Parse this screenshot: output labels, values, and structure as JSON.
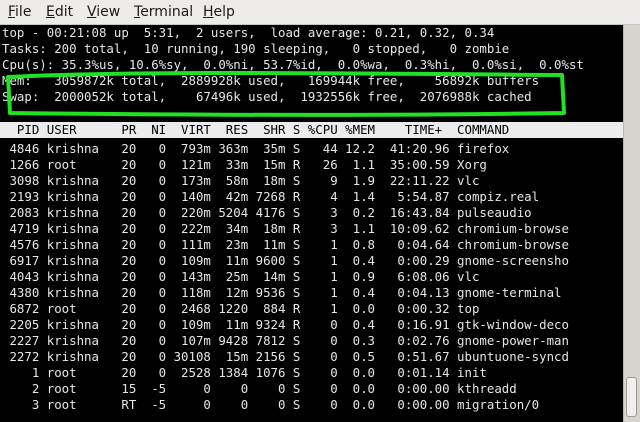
{
  "menubar": {
    "file": {
      "a": "F",
      "b": "ile"
    },
    "edit": {
      "a": "E",
      "b": "dit"
    },
    "view": {
      "a": "V",
      "b": "iew"
    },
    "terminal": {
      "a": "T",
      "b": "erminal"
    },
    "help": {
      "a": "H",
      "b": "elp"
    }
  },
  "summary": {
    "line1": "top - 00:21:08 up  5:31,  2 users,  load average: 0.21, 0.32, 0.34",
    "line2": "Tasks: 200 total,  10 running, 190 sleeping,   0 stopped,   0 zombie",
    "line3": "Cpu(s): 35.3%us, 10.6%sy,  0.0%ni, 53.7%id,  0.0%wa,  0.3%hi,  0.0%si,  0.0%st",
    "mem": "Mem:   3059872k total,  2889928k used,   169944k free,    56892k buffers",
    "swap": "Swap:  2000052k total,    67496k used,  1932556k free,  2076988k cached"
  },
  "header": "  PID USER      PR  NI  VIRT  RES  SHR S %CPU %MEM    TIME+  COMMAND",
  "processes": [
    " 4846 krishna   20   0  793m 363m  35m S   44 12.2  41:20.96 firefox",
    " 1266 root      20   0  121m  33m  15m R   26  1.1  35:00.59 Xorg",
    " 3098 krishna   20   0  173m  58m  18m S    9  1.9  22:11.22 vlc",
    " 2193 krishna   20   0  140m  42m 7268 R    4  1.4   5:54.87 compiz.real",
    " 2083 krishna   20   0  220m 5204 4176 S    3  0.2  16:43.84 pulseaudio",
    " 4719 krishna   20   0  222m  34m  18m R    3  1.1  10:09.62 chromium-browse",
    " 4576 krishna   20   0  111m  23m  11m S    1  0.8   0:04.64 chromium-browse",
    " 6917 krishna   20   0  109m  11m 9600 S    1  0.4   0:00.29 gnome-screensho",
    " 4043 krishna   20   0  143m  25m  14m S    1  0.9   6:08.06 vlc",
    " 4380 krishna   20   0  118m  12m 9536 S    1  0.4   0:04.13 gnome-terminal",
    " 6872 root      20   0  2468 1220  884 R    1  0.0   0:00.32 top",
    " 2205 krishna   20   0  109m  11m 9324 R    0  0.4   0:16.91 gtk-window-deco",
    " 2227 krishna   20   0  107m 9428 7812 S    0  0.3   0:02.76 gnome-power-man",
    " 2272 krishna   20   0 30108  15m 2156 S    0  0.5   0:51.67 ubuntuone-syncd",
    "    1 root      20   0  2528 1384 1076 S    0  0.0   0:01.14 init",
    "    2 root      15  -5     0    0    0 S    0  0.0   0:00.00 kthreadd",
    "    3 root      RT  -5     0    0    0 S    0  0.0   0:00.00 migration/0"
  ],
  "colors": {
    "highlight": "#22e022",
    "terminal_bg": "#000000",
    "terminal_fg": "#e6e6e6"
  }
}
